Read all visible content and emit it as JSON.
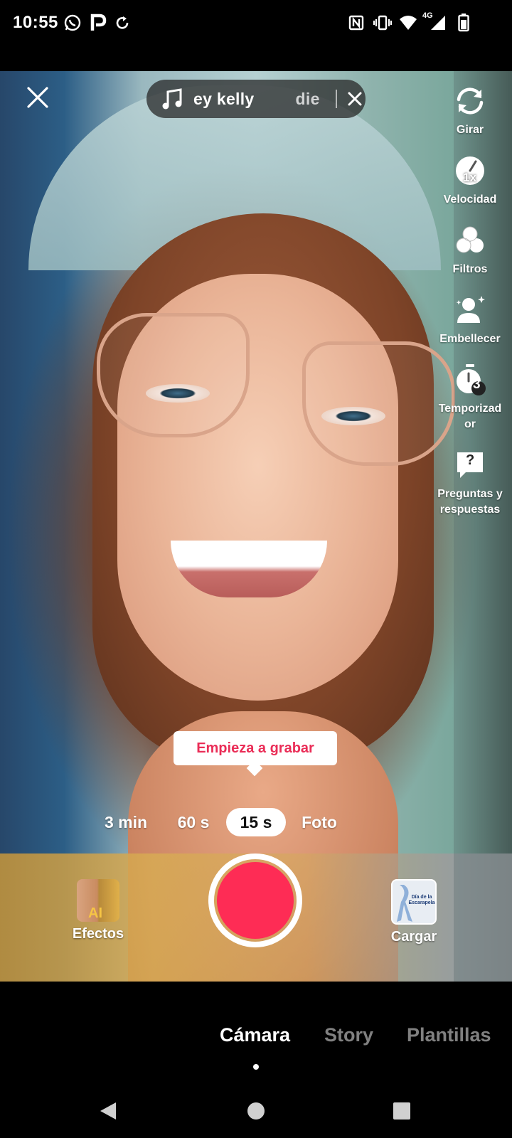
{
  "status_bar": {
    "time": "10:55",
    "network_label": "4G",
    "icons": [
      "whatsapp-icon",
      "p-app-icon",
      "sync-icon",
      "nfc-icon",
      "vibrate-icon",
      "wifi-icon",
      "signal-icon",
      "battery-icon"
    ]
  },
  "music": {
    "title": "ey kelly",
    "title_tail": "die",
    "icon": "music-note-icon"
  },
  "side_tools": [
    {
      "label": "Girar",
      "icon": "flip-camera-icon"
    },
    {
      "label": "Velocidad",
      "icon": "speed-icon",
      "badge": "1x"
    },
    {
      "label": "Filtros",
      "icon": "filters-icon"
    },
    {
      "label": "Embellecer",
      "icon": "beautify-icon"
    },
    {
      "label": "Temporizad",
      "label_line2": "or",
      "icon": "timer-icon",
      "badge": "3"
    },
    {
      "label": "Preguntas y",
      "label_line2": "respuestas",
      "icon": "qa-icon",
      "badge": "?"
    }
  ],
  "tooltip": "Empieza a grabar",
  "durations": [
    "3 min",
    "60 s",
    "15 s",
    "Foto"
  ],
  "selected_duration": "15 s",
  "effects": {
    "label": "Efectos",
    "badge": "AI"
  },
  "upload": {
    "label": "Cargar",
    "thumb_text": "Día de la Escarapela"
  },
  "modes": [
    "Cámara",
    "Story",
    "Plantillas"
  ],
  "selected_mode": "Cámara",
  "colors": {
    "record": "#fe2c55",
    "tooltip_text": "#ea2d57"
  }
}
